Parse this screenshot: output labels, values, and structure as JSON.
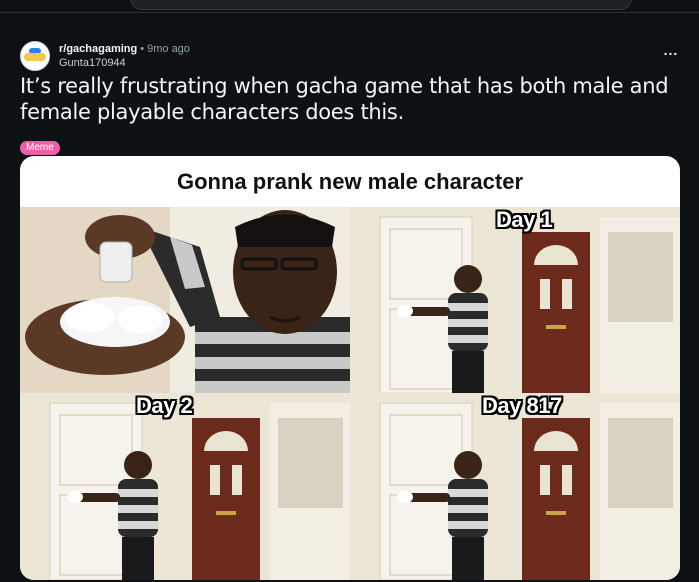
{
  "post": {
    "subreddit": "r/gachagaming",
    "separator": "•",
    "age": "9mo ago",
    "author": "Gunta170944",
    "more_label": "...",
    "title": "It’s really frustrating when gacha game that has both male and female playable characters does this.",
    "flair": "Meme"
  },
  "meme": {
    "caption": "Gonna prank new male character",
    "panels": [
      {
        "label": ""
      },
      {
        "label": "Day 1"
      },
      {
        "label": "Day 2"
      },
      {
        "label": "Day 817"
      }
    ]
  },
  "colors": {
    "background": "#0e1113",
    "flair": "#ee5ea8",
    "muted_text": "#8ba2ad"
  }
}
